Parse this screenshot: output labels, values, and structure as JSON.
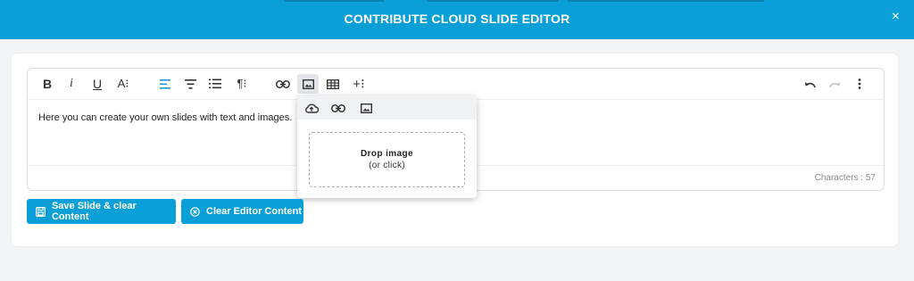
{
  "modal": {
    "title": "CONTRIBUTE CLOUD SLIDE EDITOR",
    "close_glyph": "×"
  },
  "toolbar": {
    "bold": "B",
    "italic": "i",
    "underline": "U",
    "font_size": "A⁝",
    "paragraph": "¶⁝",
    "insert_more": "+⁝"
  },
  "editor": {
    "content": "Here you can create your own slides with text and images.",
    "char_count": "Characters : 57"
  },
  "image_popup": {
    "drop_title": "Drop image",
    "drop_hint": "(or click)"
  },
  "actions": {
    "save_label": "Save Slide & clear Content",
    "clear_label": "Clear Editor Content"
  },
  "colors": {
    "accent": "#0b9fd8"
  }
}
